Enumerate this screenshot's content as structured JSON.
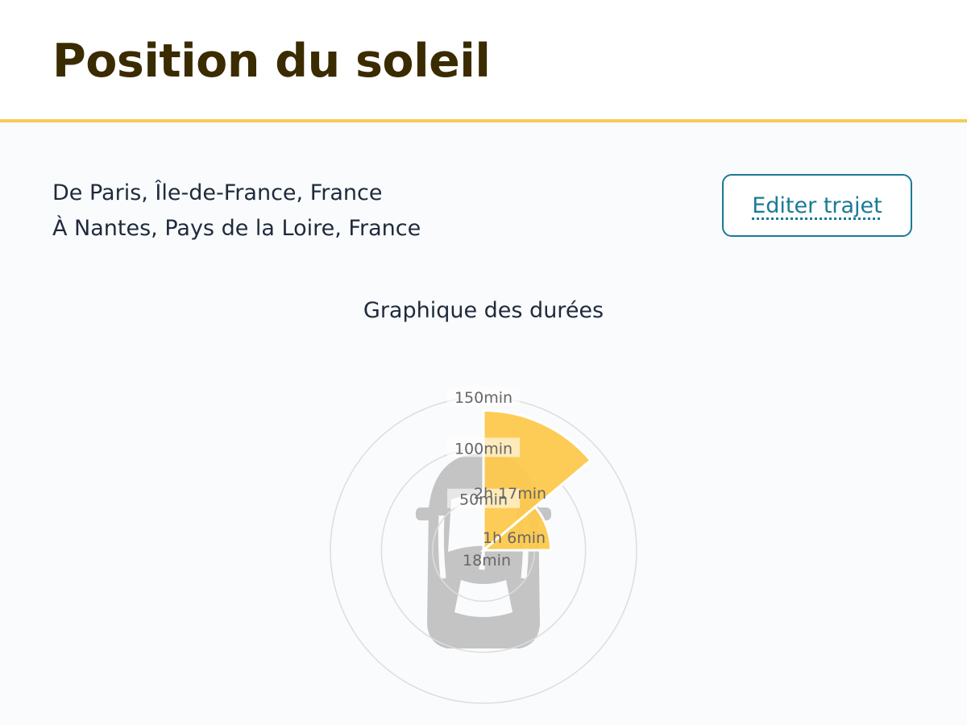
{
  "header": {
    "title": "Position du soleil"
  },
  "route": {
    "from": "De Paris, Île-de-France, France",
    "to": "À Nantes, Pays de la Loire, France"
  },
  "actions": {
    "edit_label": "Editer trajet"
  },
  "chart_title": "Graphique des durées",
  "colors": {
    "title": "#3b2b00",
    "accent": "#f8c95a",
    "sector_fill": "#fdc94d",
    "link": "#1a7a96",
    "car": "#c4c4c4"
  },
  "icons": {
    "vehicle": "car-top-view-icon"
  },
  "chart_data": {
    "type": "polar-area",
    "title": "Graphique des durées",
    "unit": "min",
    "radial_ticks": [
      {
        "value": 50,
        "label": "50min"
      },
      {
        "value": 100,
        "label": "100min"
      },
      {
        "value": 150,
        "label": "150min"
      }
    ],
    "r_max": 150,
    "sectors": [
      {
        "start_deg": 0,
        "end_deg": 50,
        "value": 137,
        "label": "2h 17min"
      },
      {
        "start_deg": 50,
        "end_deg": 90,
        "value": 66,
        "label": "1h 6min"
      },
      {
        "start_deg": 180,
        "end_deg": 190,
        "value": 18,
        "label": "18min"
      }
    ]
  }
}
